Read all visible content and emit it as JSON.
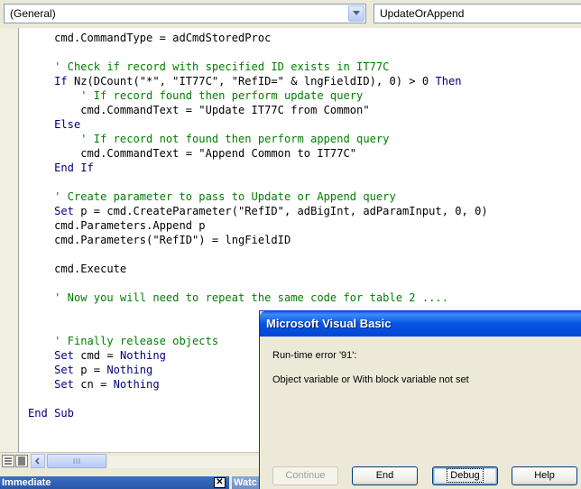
{
  "toolbar": {
    "object_combo": "(General)",
    "procedure_combo": "UpdateOrAppend"
  },
  "code_lines": [
    [
      {
        "t": "    cmd.CommandType = adCmdStoredProc",
        "c": ""
      }
    ],
    [
      {
        "t": "",
        "c": ""
      }
    ],
    [
      {
        "t": "    ' Check if record with specified ID exists in IT77C",
        "c": "cm"
      }
    ],
    [
      {
        "t": "    If",
        "c": "kw"
      },
      {
        "t": " Nz(DCount(\"*\", \"IT77C\", \"RefID=\" & lngFieldID), 0) > 0 ",
        "c": ""
      },
      {
        "t": "Then",
        "c": "kw"
      }
    ],
    [
      {
        "t": "        ' If record found then perform update query",
        "c": "cm"
      }
    ],
    [
      {
        "t": "        cmd.CommandText = \"Update IT77C from Common\"",
        "c": ""
      }
    ],
    [
      {
        "t": "    Else",
        "c": "kw"
      }
    ],
    [
      {
        "t": "        ' If record not found then perform append query",
        "c": "cm"
      }
    ],
    [
      {
        "t": "        cmd.CommandText = \"Append Common to IT77C\"",
        "c": ""
      }
    ],
    [
      {
        "t": "    End If",
        "c": "kw"
      }
    ],
    [
      {
        "t": "",
        "c": ""
      }
    ],
    [
      {
        "t": "    ' Create parameter to pass to Update or Append query",
        "c": "cm"
      }
    ],
    [
      {
        "t": "    Set",
        "c": "kw"
      },
      {
        "t": " p = cmd.CreateParameter(\"RefID\", adBigInt, adParamInput, 0, 0)",
        "c": ""
      }
    ],
    [
      {
        "t": "    cmd.Parameters.Append p",
        "c": ""
      }
    ],
    [
      {
        "t": "    cmd.Parameters(\"RefID\") = lngFieldID",
        "c": ""
      }
    ],
    [
      {
        "t": "",
        "c": ""
      }
    ],
    [
      {
        "t": "    cmd.Execute",
        "c": ""
      }
    ],
    [
      {
        "t": "",
        "c": ""
      }
    ],
    [
      {
        "t": "    ' Now you will need to repeat the same code for table 2 ....",
        "c": "cm"
      }
    ],
    [
      {
        "t": "",
        "c": ""
      }
    ],
    [
      {
        "t": "",
        "c": ""
      }
    ],
    [
      {
        "t": "    ' Finally release objects",
        "c": "cm"
      }
    ],
    [
      {
        "t": "    Set",
        "c": "kw"
      },
      {
        "t": " cmd = ",
        "c": ""
      },
      {
        "t": "Nothing",
        "c": "kw"
      }
    ],
    [
      {
        "t": "    Set",
        "c": "kw"
      },
      {
        "t": " p = ",
        "c": ""
      },
      {
        "t": "Nothing",
        "c": "kw"
      }
    ],
    [
      {
        "t": "    Set",
        "c": "kw"
      },
      {
        "t": " cn = ",
        "c": ""
      },
      {
        "t": "Nothing",
        "c": "kw"
      }
    ],
    [
      {
        "t": "",
        "c": ""
      }
    ],
    [
      {
        "t": "End Sub",
        "c": "kw"
      }
    ]
  ],
  "dock": {
    "immediate_title": "Immediate",
    "watch_title": "Watc"
  },
  "msgbox": {
    "title": "Microsoft Visual Basic",
    "error_line": "Run-time error '91':",
    "message": "Object variable or With block variable not set",
    "buttons": {
      "continue": "Continue",
      "end": "End",
      "debug": "Debug",
      "help": "Help"
    }
  }
}
